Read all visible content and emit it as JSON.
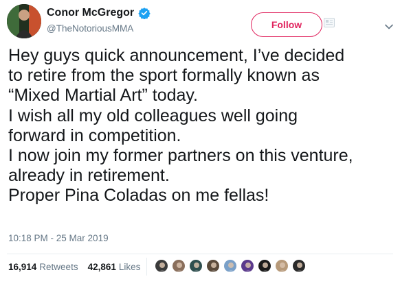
{
  "user": {
    "display_name": "Conor McGregor",
    "handle": "@TheNotoriousMMA",
    "verified": true,
    "avatar_icon": "profile-photo-icon"
  },
  "actions": {
    "follow_label": "Follow",
    "add_icon": "user-add-icon",
    "more_icon": "chevron-down-icon"
  },
  "tweet": {
    "lines": [
      "Hey guys quick announcement, I’ve decided",
      "to retire from the sport formally known as",
      "“Mixed Martial Art” today.",
      "I wish all my old colleagues well going",
      "forward in competition.",
      "I now join my former partners on this venture,",
      "already in retirement.",
      "Proper Pina Coladas on me fellas!"
    ],
    "timestamp": "10:18 PM - 25 Mar 2019"
  },
  "stats": {
    "retweets_count": "16,914",
    "retweets_label": "Retweets",
    "likes_count": "42,861",
    "likes_label": "Likes"
  },
  "likers": [
    {
      "icon": "liker-avatar-icon",
      "color": "#3b3b3b"
    },
    {
      "icon": "liker-avatar-icon",
      "color": "#8a6f5c"
    },
    {
      "icon": "liker-avatar-icon",
      "color": "#2f4f4f"
    },
    {
      "icon": "liker-avatar-icon",
      "color": "#5a4a3a"
    },
    {
      "icon": "liker-avatar-icon",
      "color": "#7aa0c8"
    },
    {
      "icon": "liker-avatar-icon",
      "color": "#5b3a8c"
    },
    {
      "icon": "liker-avatar-icon",
      "color": "#1a1a1a"
    },
    {
      "icon": "liker-avatar-icon",
      "color": "#b79a7a"
    },
    {
      "icon": "liker-avatar-icon",
      "color": "#2a2a2a"
    }
  ],
  "colors": {
    "follow_accent": "#e0245e",
    "verified_blue": "#1da1f2",
    "muted_text": "#657786"
  }
}
